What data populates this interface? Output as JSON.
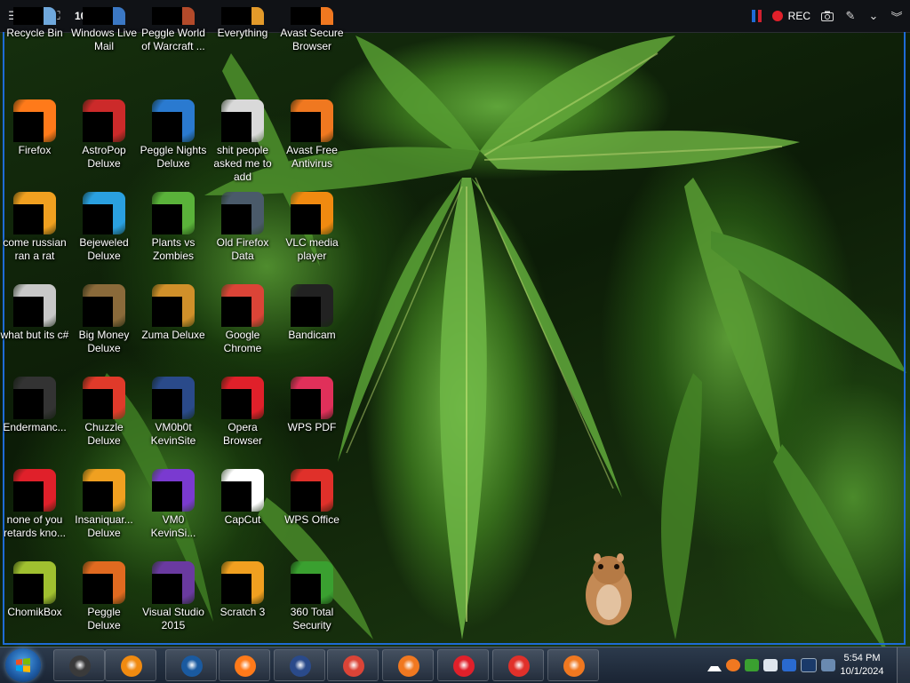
{
  "recorder": {
    "resolution": "1018x735",
    "rec_label": "REC"
  },
  "desktop_icons": [
    {
      "label": "Recycle Bin",
      "color": "#6fa8dc"
    },
    {
      "label": "Windows Live Mail",
      "color": "#3b78c4"
    },
    {
      "label": "Peggle World of Warcraft ...",
      "color": "#b34a2a"
    },
    {
      "label": "Everything",
      "color": "#e39a2a"
    },
    {
      "label": "Avast Secure Browser",
      "color": "#f07820"
    },
    {
      "label": "Firefox",
      "color": "#ff7a1a"
    },
    {
      "label": "AstroPop Deluxe",
      "color": "#cc2a2a"
    },
    {
      "label": "Peggle Nights Deluxe",
      "color": "#2a7ad0"
    },
    {
      "label": "shit people asked me to add",
      "color": "#d9d9d9"
    },
    {
      "label": "Avast Free Antivirus",
      "color": "#f07820"
    },
    {
      "label": "come russian ran a rat",
      "color": "#f0a020"
    },
    {
      "label": "Bejeweled Deluxe",
      "color": "#2aa0e0"
    },
    {
      "label": "Plants vs Zombies",
      "color": "#5ab23a"
    },
    {
      "label": "Old Firefox Data",
      "color": "#4a5a6a"
    },
    {
      "label": "VLC media player",
      "color": "#f08a10"
    },
    {
      "label": "what but its c#",
      "color": "#c8c8c8"
    },
    {
      "label": "Big Money Deluxe",
      "color": "#8a6a3a"
    },
    {
      "label": "Zuma Deluxe",
      "color": "#d0902a"
    },
    {
      "label": "Google Chrome",
      "color": "#db4437"
    },
    {
      "label": "Bandicam",
      "color": "#222222"
    },
    {
      "label": "Endermanc...",
      "color": "#333333"
    },
    {
      "label": "Chuzzle Deluxe",
      "color": "#e03a2a"
    },
    {
      "label": "VM0b0t KevinSite",
      "color": "#2a4a8a"
    },
    {
      "label": "Opera Browser",
      "color": "#e0202a"
    },
    {
      "label": "WPS PDF",
      "color": "#e0305a"
    },
    {
      "label": "none of you retards kno...",
      "color": "#e0202a"
    },
    {
      "label": "Insaniquar... Deluxe",
      "color": "#f0a020"
    },
    {
      "label": "VM0 KevinSi...",
      "color": "#7a3ad0"
    },
    {
      "label": "CapCut",
      "color": "#ffffff"
    },
    {
      "label": "WPS Office",
      "color": "#e0302a"
    },
    {
      "label": "ChomikBox",
      "color": "#a0c030"
    },
    {
      "label": "Peggle Deluxe",
      "color": "#e06a20"
    },
    {
      "label": "Visual Studio 2015",
      "color": "#6a3aa0"
    },
    {
      "label": "Scratch 3",
      "color": "#f0a020"
    },
    {
      "label": "360 Total Security",
      "color": "#3aa030"
    }
  ],
  "taskbar": {
    "items": [
      {
        "name": "taskbar-item-explorer",
        "color": "#3a3a3a"
      },
      {
        "name": "taskbar-item-media-player",
        "color": "#f08a10"
      },
      {
        "name": "taskbar-item-globe",
        "color": "#1a5aa0"
      },
      {
        "name": "taskbar-item-firefox",
        "color": "#ff7a1a"
      },
      {
        "name": "taskbar-item-app",
        "color": "#2a4a8a"
      },
      {
        "name": "taskbar-item-chrome",
        "color": "#db4437"
      },
      {
        "name": "taskbar-item-avast-browser",
        "color": "#f07820"
      },
      {
        "name": "taskbar-item-bandicam",
        "color": "#e0202a"
      },
      {
        "name": "taskbar-item-wps",
        "color": "#e0302a"
      },
      {
        "name": "taskbar-item-avast",
        "color": "#f07820"
      }
    ],
    "clock_time": "5:54 PM",
    "clock_date": "10/1/2024"
  }
}
